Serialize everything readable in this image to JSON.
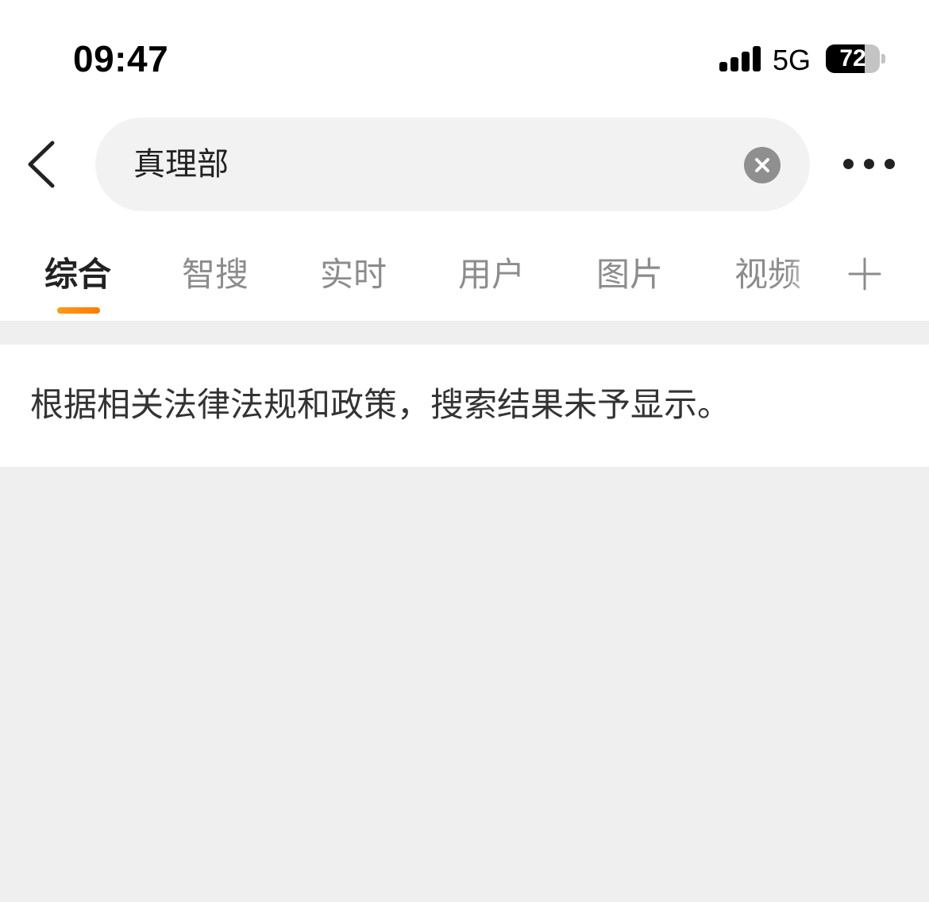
{
  "status_bar": {
    "time": "09:47",
    "network": "5G",
    "battery_level": "72",
    "battery_fraction": 0.72,
    "signal_bars_active": 4,
    "signal_bars_total": 4
  },
  "search": {
    "query": "真理部",
    "back_icon": "chevron-left-icon",
    "clear_icon": "close-circle-icon",
    "more_icon": "more-horizontal-icon"
  },
  "tabs": [
    {
      "label": "综合",
      "active": true
    },
    {
      "label": "智搜",
      "active": false
    },
    {
      "label": "实时",
      "active": false
    },
    {
      "label": "用户",
      "active": false
    },
    {
      "label": "图片",
      "active": false
    },
    {
      "label": "视频",
      "active": false
    }
  ],
  "add_tab_icon": "plus-icon",
  "notice": {
    "text": "根据相关法律法规和政策，搜索结果未予显示。"
  },
  "colors": {
    "accent": "#ff8a00",
    "tab_active": "#222222",
    "tab_inactive": "#8c8c8c",
    "page_background": "#efefef",
    "search_box_background": "#f2f2f2"
  }
}
